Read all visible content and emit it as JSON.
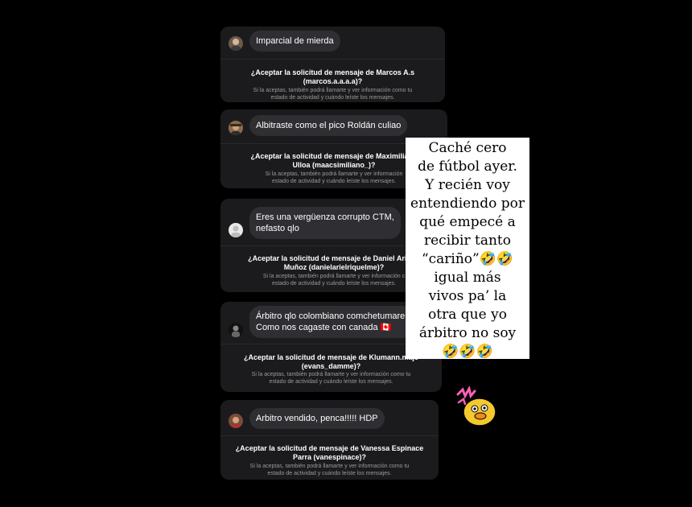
{
  "requests": [
    {
      "message": "Imparcial de mierda",
      "title": "¿Aceptar la solicitud de mensaje de Marcos A.s\n(marcos.a.a.a.a)?",
      "subtitle": "Si la aceptas, también podrá llamarte y ver información como tu\nestado de actividad y cuándo leíste los mensajes."
    },
    {
      "message": "Albitraste como el pico Roldán culiao",
      "title": "¿Aceptar la solicitud de mensaje de Maximiliano\nUlloa (maacsimiliano_)?",
      "subtitle": "Si la aceptas, también podrá llamarte y ver información\nestado de actividad y cuándo leíste los mensajes."
    },
    {
      "message": "Eres una vergüenza corrupto CTM,\nnefasto qlo",
      "title": "¿Aceptar la solicitud de mensaje de Daniel Ariel R\nMuñoz (danielarielriquelme)?",
      "subtitle": "Si la aceptas, también podrá llamarte y ver información c\nestado de actividad y cuándo leíste los mensajes."
    },
    {
      "message": "Árbitro qlo colombiano comchetumare!\nComo nos cagaste con canada 🇨🇦",
      "title": "¿Aceptar la solicitud de mensaje de Klumann.maje\n(evans_damme)?",
      "subtitle": "Si la aceptas, también podrá llamarte y ver información como tu\nestado de actividad y cuándo leíste los mensajes."
    },
    {
      "message": "Arbitro vendido, penca!!!!! HDP",
      "title": "¿Aceptar la solicitud de mensaje de Vanessa Espinace\nParra (vanespinace)?",
      "subtitle": "Si la aceptas, también podrá llamarte y ver información como tu\nestado de actividad y cuándo leíste los mensajes."
    }
  ],
  "overlay_text": "Caché cero\nde fútbol ayer.\nY recién voy\nentendiendo por\nqué empecé a\nrecibir tanto\n“cariño”🤣🤣\nigual más\nvivos pa’ la\notra que yo\nárbitro no soy\n🤣🤣🤣",
  "sticker_icon": "duck-sticker"
}
